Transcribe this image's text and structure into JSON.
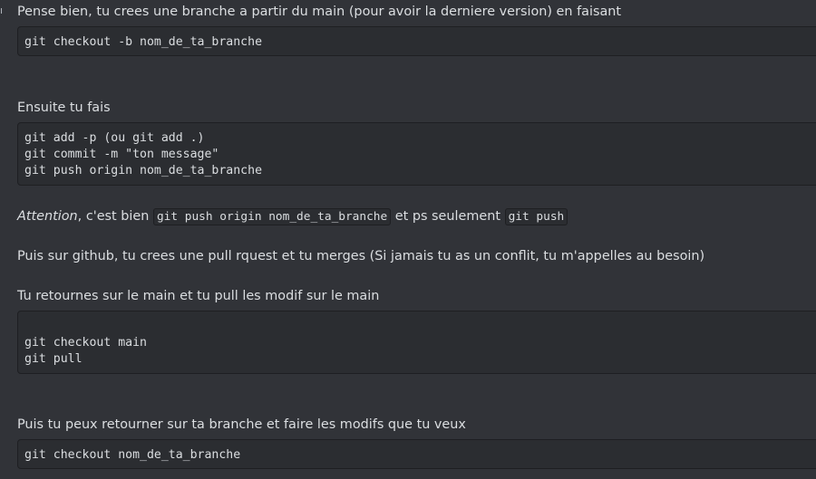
{
  "edge_glyph": "ı",
  "messages": {
    "p1": "Pense bien, tu crees une branche a partir du main (pour avoir la derniere version) en faisant",
    "code1": [
      "git checkout -b nom_de_ta_branche"
    ],
    "p2": "Ensuite tu fais",
    "code2": [
      "git add -p (ou git add .)",
      "git commit -m \"ton message\"",
      "git push origin nom_de_ta_branche"
    ],
    "p3": {
      "emphasis": "Attention",
      "text_a": ", c'est bien ",
      "inline_code_a": "git push origin nom_de_ta_branche",
      "text_b": " et ps seulement ",
      "inline_code_b": "git push"
    },
    "p4": "Puis sur github, tu crees une pull rquest et tu merges (Si jamais tu as un conflit, tu m'appelles au besoin)",
    "p5": "Tu retournes sur le main et tu pull les modif sur le main",
    "code3": [
      "",
      "git checkout main",
      "git pull"
    ],
    "p6": "Puis tu peux retourner sur ta branche et faire les modifs que tu veux",
    "code4": [
      "git checkout nom_de_ta_branche"
    ]
  },
  "colors": {
    "background": "#313338",
    "code_background": "#2b2d31",
    "text": "#dbdee1"
  }
}
